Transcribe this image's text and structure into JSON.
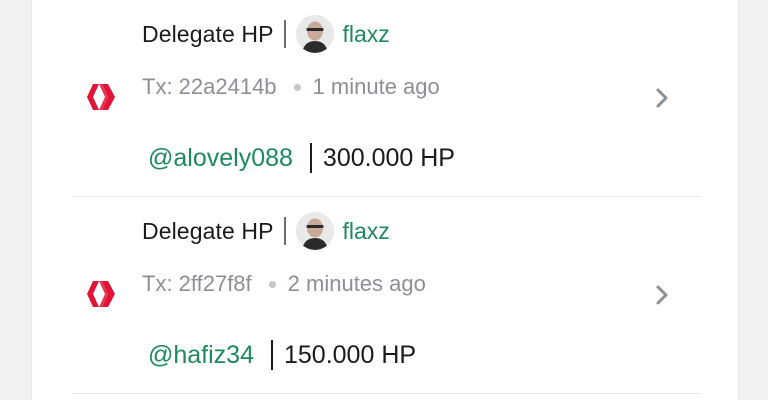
{
  "colors": {
    "accent_green": "#1c8a5c",
    "hive_red": "#e31337",
    "muted_text": "#8b9096",
    "background": "#f1f2f4"
  },
  "transactions": [
    {
      "icon": "hive-logo-icon",
      "op_title": "Delegate HP",
      "author": "flaxz",
      "tx_id": "Tx: 22a2414b",
      "time_ago": "1 minute ago",
      "delegatee": "@alovely088",
      "amount": "300.000 HP"
    },
    {
      "icon": "hive-logo-icon",
      "op_title": "Delegate HP",
      "author": "flaxz",
      "tx_id": "Tx: 2ff27f8f",
      "time_ago": "2 minutes ago",
      "delegatee": "@hafiz34",
      "amount": "150.000 HP"
    }
  ]
}
